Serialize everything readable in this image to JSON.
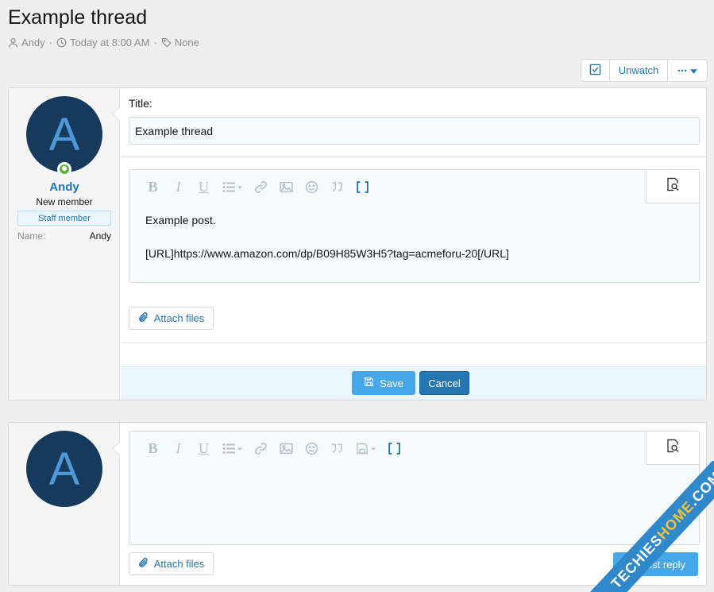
{
  "thread": {
    "title": "Example thread",
    "author": "Andy",
    "date": "Today at 8:00 AM",
    "tags": "None",
    "separator": "·"
  },
  "watch_controls": {
    "unwatch_label": "Unwatch",
    "more_label": "•••"
  },
  "post": {
    "user": {
      "avatar_letter": "A",
      "name": "Andy",
      "title": "New member",
      "badge": "Staff member",
      "info_key": "Name:",
      "info_value": "Andy"
    },
    "title_label": "Title:",
    "title_value": "Example thread",
    "body_lines": [
      "Example post.",
      "[URL]https://www.amazon.com/dp/B09H85W3H5?tag=acmeforu-20[/URL]"
    ],
    "attach_label": "Attach files",
    "save_label": "Save",
    "cancel_label": "Cancel"
  },
  "reply": {
    "avatar_letter": "A",
    "attach_label": "Attach files",
    "post_label": "ost reply"
  },
  "watermark": {
    "part1": "TECHIES",
    "part2": "HOME",
    "part3": ".COM"
  },
  "colors": {
    "link": "#2577b1",
    "primary_button": "#47a7eb",
    "cancel_button": "#2577b1",
    "avatar_bg": "#163a5c",
    "avatar_letter": "#4e97d8",
    "online": "#63b141",
    "watermark": "#2f88c9"
  }
}
